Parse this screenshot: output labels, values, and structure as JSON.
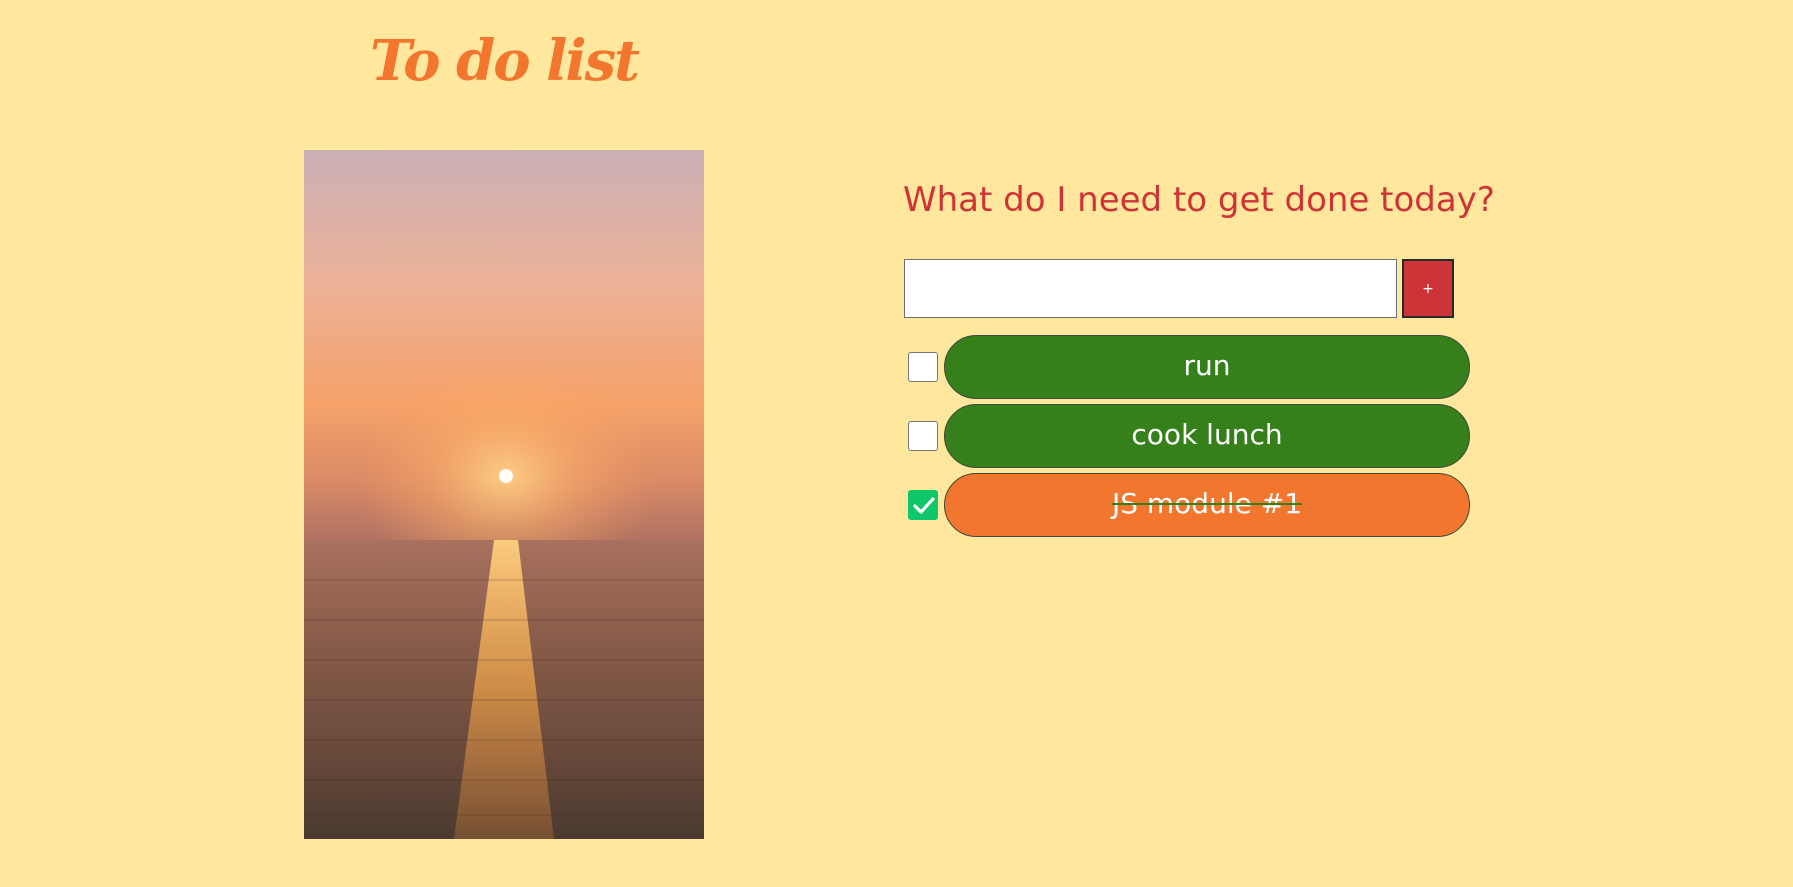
{
  "app": {
    "title": "To do list"
  },
  "photo": {
    "description_icon": "sunset-over-sea-image"
  },
  "form": {
    "question": "What do I need to get done today?",
    "input_value": "",
    "input_placeholder": "",
    "add_label": "+"
  },
  "todos": [
    {
      "text": "run",
      "done": false
    },
    {
      "text": "cook lunch",
      "done": false
    },
    {
      "text": "JS module #1",
      "done": true
    }
  ],
  "colors": {
    "background": "#ffe89d",
    "title": "#f2762e",
    "question": "#cf3336",
    "add_button": "#cd3438",
    "pending_task": "#36801c",
    "done_task": "#f2762e",
    "checkbox_checked": "#0ec76a"
  }
}
